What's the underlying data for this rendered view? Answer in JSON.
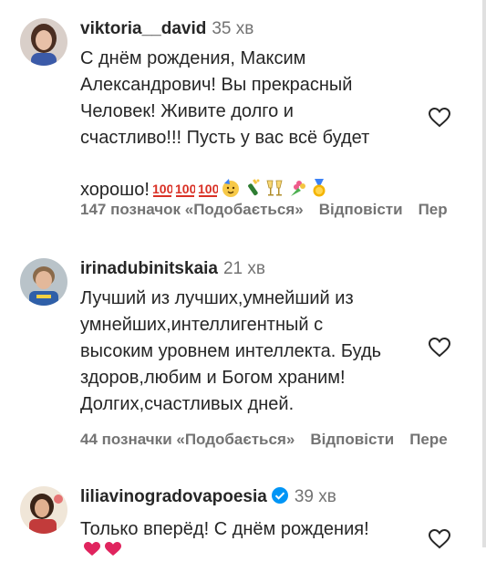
{
  "comments": [
    {
      "username": "viktoria__david",
      "time": "35 хв",
      "text": "С днём рождения, Максим\nАлександрович! Вы прекрасный\nЧеловек! Живите долго и\nсчастливо!!! Пусть у вас всё будет\nхорошо!",
      "emojis": [
        "hundred-icon",
        "hundred-icon",
        "hundred-icon",
        "partying-face-icon",
        "champagne-icon",
        "clinking-glasses-icon",
        "bouquet-icon",
        "medal-icon"
      ],
      "likes": "147 позначок «Подобається»",
      "reply": "Відповісти",
      "more": "Пер"
    },
    {
      "username": "irinadubinitskaia",
      "time": "21 хв",
      "text": "Лучший из лучших,умнейший из\nумнейших,интеллигентный с\nвысоким уровнем интеллекта. Будь\nздоров,любим и Богом храним!\nДолгих,счастливых дней.",
      "likes": "44 позначки «Подобається»",
      "reply": "Відповісти",
      "more": "Пере"
    },
    {
      "username": "liliavinogradovapoesia",
      "verified": true,
      "time": "39 хв",
      "text": "Только вперёд! С днём рождения!"
    }
  ],
  "colors": {
    "text": "#262626",
    "muted": "#737373",
    "verified": "#0095f6"
  }
}
